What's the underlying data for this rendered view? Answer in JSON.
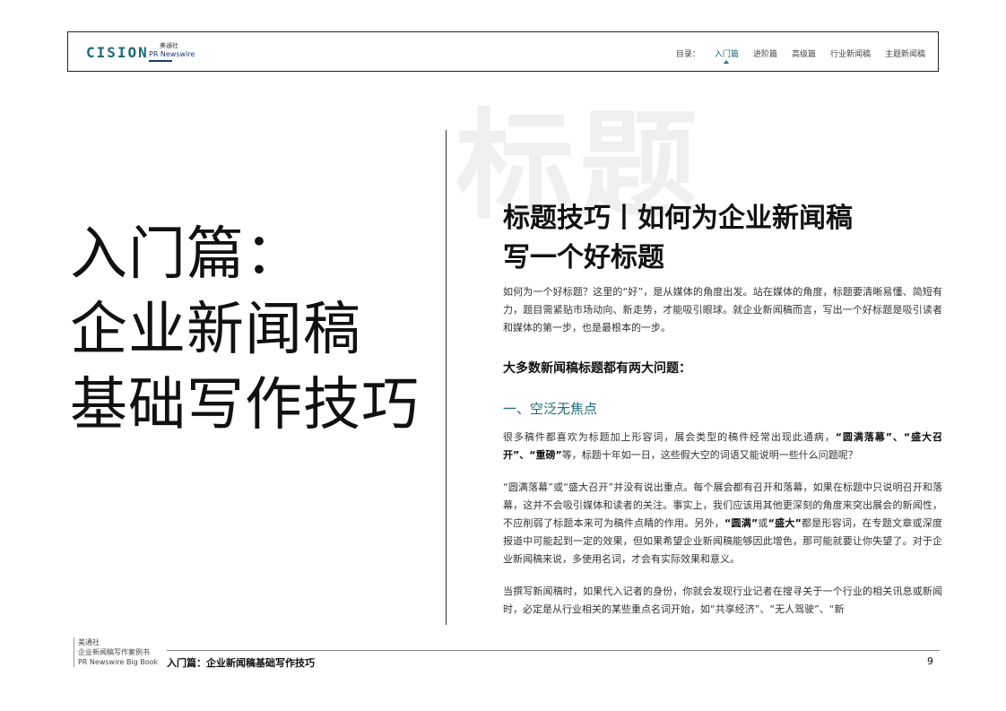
{
  "header": {
    "logo_cision": "CISION",
    "logo_prn_cn": "美通社",
    "logo_prn_en": "PR Newswire",
    "nav_label": "目录：",
    "nav_items": [
      "入门篇",
      "进阶篇",
      "高级篇",
      "行业新闻稿",
      "主题新闻稿"
    ],
    "active_nav": "入门篇"
  },
  "left": {
    "title_lines": [
      "入门篇：",
      "企业新闻稿",
      "基础写作技巧"
    ]
  },
  "right": {
    "watermark": "标题",
    "title_lines": [
      "标题技巧丨如何为企业新闻稿",
      "写一个好标题"
    ],
    "intro": "如何为一个好标题？这里的“好”，是从媒体的角度出发。站在媒体的角度，标题要清晰易懂、简短有力，题目需紧贴市场动向、新走势，才能吸引眼球。就企业新闻稿而言，写出一个好标题是吸引读者和媒体的第一步，也是最根本的一步。",
    "subheading": "大多数新闻稿标题都有两大问题：",
    "section_title": "一、空泛无焦点",
    "p1": {
      "a": "很多稿件都喜欢为标题加上形容词，展会类型的稿件经常出现此通病，",
      "b": "“圆满落幕”、“盛大召开”、“重磅”",
      "c": "等，标题十年如一日，这些假大空的词语又能说明一些什么问题呢？"
    },
    "p2": {
      "a": "“圆满落幕”或“盛大召开”并没有说出重点。每个展会都有召开和落幕，如果在标题中只说明召开和落幕，这并不会吸引媒体和读者的关注。事实上，我们应该用其他更深刻的角度来突出展会的新闻性，不应削弱了标题本来可为稿件点睛的作用。另外，",
      "b1": "“圆满”",
      "mid": "或",
      "b2": "“盛大”",
      "c": "都是形容词，在专题文章或深度报道中可能起到一定的效果，但如果希望企业新闻稿能够因此增色，那可能就要让你失望了。对于企业新闻稿来说，多使用名词，才会有实际效果和意义。"
    },
    "p3": "当撰写新闻稿时，如果代入记者的身份，你就会发现行业记者在搜寻关于一个行业的相关讯息或新闻时，必定是从行业相关的某些重点名词开始，如“共享经济”、“无人驾驶”、“新"
  },
  "footer": {
    "meta_line1": "美通社",
    "meta_line2": "企业新闻稿写作案例书",
    "meta_line3": "PR Newswire Big Book",
    "chapter": "入门篇：企业新闻稿基础写作技巧",
    "page": "9"
  }
}
